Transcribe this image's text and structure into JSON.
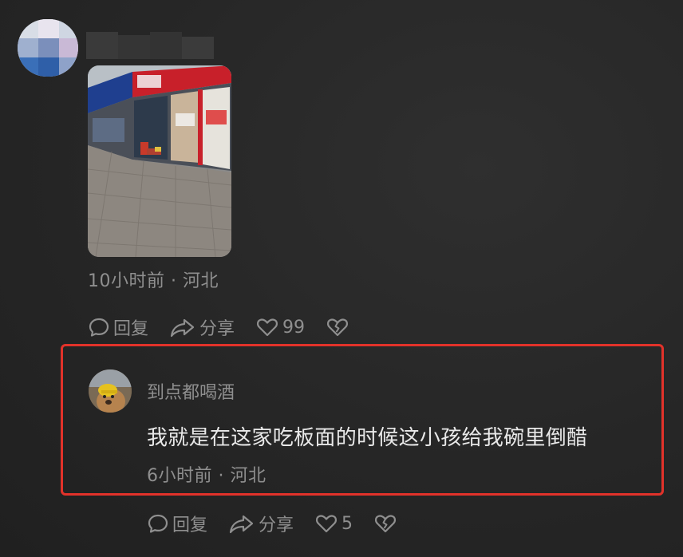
{
  "post": {
    "meta": "10小时前 · 河北",
    "actions": {
      "reply_label": "回复",
      "share_label": "分享",
      "like_count": "99"
    }
  },
  "comment": {
    "username": "到点都喝酒",
    "text": "我就是在这家吃板面的时候这小孩给我碗里倒醋",
    "meta": "6小时前 · 河北",
    "actions": {
      "reply_label": "回复",
      "share_label": "分享",
      "like_count": "5"
    }
  },
  "icons": {
    "reply": "comment-bubble-icon",
    "share": "share-arrow-icon",
    "like": "heart-outline-icon",
    "dislike": "broken-heart-icon"
  },
  "colors": {
    "background": "#262626",
    "muted_text": "#8f8f8f",
    "comment_text": "#e9e9e9",
    "highlight_border": "#e2322a"
  }
}
